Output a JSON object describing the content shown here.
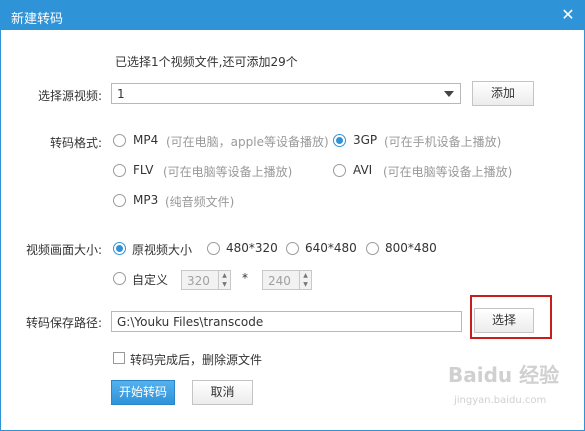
{
  "window": {
    "title": "新建转码",
    "close_glyph": "✕"
  },
  "info": {
    "selected_files": "已选择1个视频文件,还可添加29个"
  },
  "source": {
    "label": "选择源视频:",
    "value": "1",
    "add_button": "添加"
  },
  "format": {
    "label": "转码格式:",
    "options": [
      {
        "name": "MP4",
        "note": "(可在电脑，apple等设备播放)",
        "checked": false
      },
      {
        "name": "3GP",
        "note": "(可在手机设备上播放)",
        "checked": true
      },
      {
        "name": "FLV",
        "note": "(可在电脑等设备上播放)",
        "checked": false
      },
      {
        "name": "AVI",
        "note": "(可在电脑等设备上播放)",
        "checked": false
      },
      {
        "name": "MP3",
        "note": "(纯音频文件)",
        "checked": false
      }
    ]
  },
  "size": {
    "label": "视频画面大小:",
    "options": [
      "原视频大小",
      "480*320",
      "640*480",
      "800*480"
    ],
    "selected_index": 0,
    "custom_label": "自定义",
    "custom_width": "320",
    "times": "*",
    "custom_height": "240"
  },
  "save_path": {
    "label": "转码保存路径:",
    "value": "G:\\Youku Files\\transcode",
    "choose_button": "选择"
  },
  "delete_source": {
    "label": "转码完成后，删除源文件",
    "checked": false
  },
  "actions": {
    "start": "开始转码",
    "cancel": "取消"
  },
  "watermark": {
    "text": "Baidu 经验",
    "sub": "jingyan.baidu.com"
  },
  "colors": {
    "accent": "#2f93d8",
    "highlight": "#c81d1d"
  }
}
